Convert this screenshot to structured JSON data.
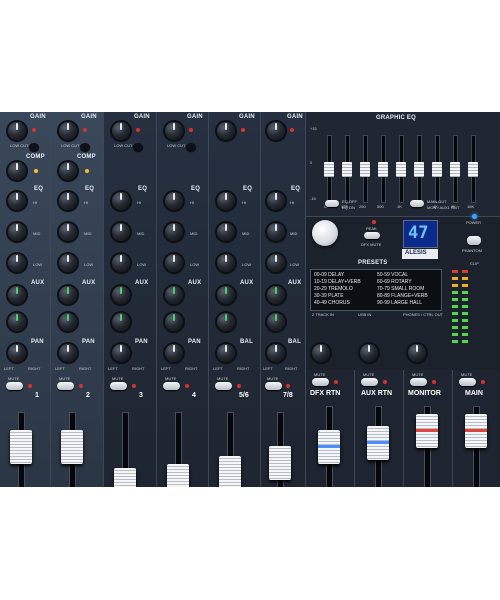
{
  "channel_labels": {
    "gain": "GAIN",
    "low_cut": "LOW CUT",
    "comp": "COMP",
    "eq": "EQ",
    "hi": "HI",
    "mid": "MID",
    "low": "LOW",
    "aux": "AUX",
    "pan": "PAN",
    "bal": "BAL",
    "left": "LEFT",
    "right": "RIGHT",
    "mute": "MUTE"
  },
  "channels": [
    "1",
    "2",
    "3",
    "4",
    "5/6",
    "7/8"
  ],
  "graphic_eq": {
    "title": "GRAPHIC EQ",
    "bands": [
      "63",
      "125",
      "250",
      "500",
      "1K",
      "2K",
      "4K",
      "8K",
      "16K"
    ],
    "eq_off": "EQ OFF",
    "eq_on": "EQ ON",
    "main_out": "MAIN OUT",
    "mon_out": "MON / AUX1 OUT"
  },
  "effects": {
    "display": "47",
    "peak": "PEAK",
    "dfx_mute": "DFX MUTE",
    "brand": "ALESIS",
    "presets_title": "PRESETS",
    "presets_left": [
      "00-09 DELAY",
      "10-19 DELAY+VERB",
      "20-29 TREMOLO",
      "30-39 PLATE",
      "40-49 CHORUS"
    ],
    "presets_right": [
      "50-59 VOCAL",
      "60-69 ROTARY",
      "70-79 SMALL ROOM",
      "80-89 FLANGE+VERB",
      "90-99 LARGE HALL"
    ]
  },
  "io": {
    "two_track": "2 TRACK IN",
    "usb": "USB IN",
    "phones": "PHONES / CTRL OUT",
    "power": "POWER",
    "phantom": "PHANTOM",
    "clip": "CLIP"
  },
  "buses": [
    "DFX RTN",
    "AUX RTN",
    "MONITOR",
    "MAIN"
  ]
}
